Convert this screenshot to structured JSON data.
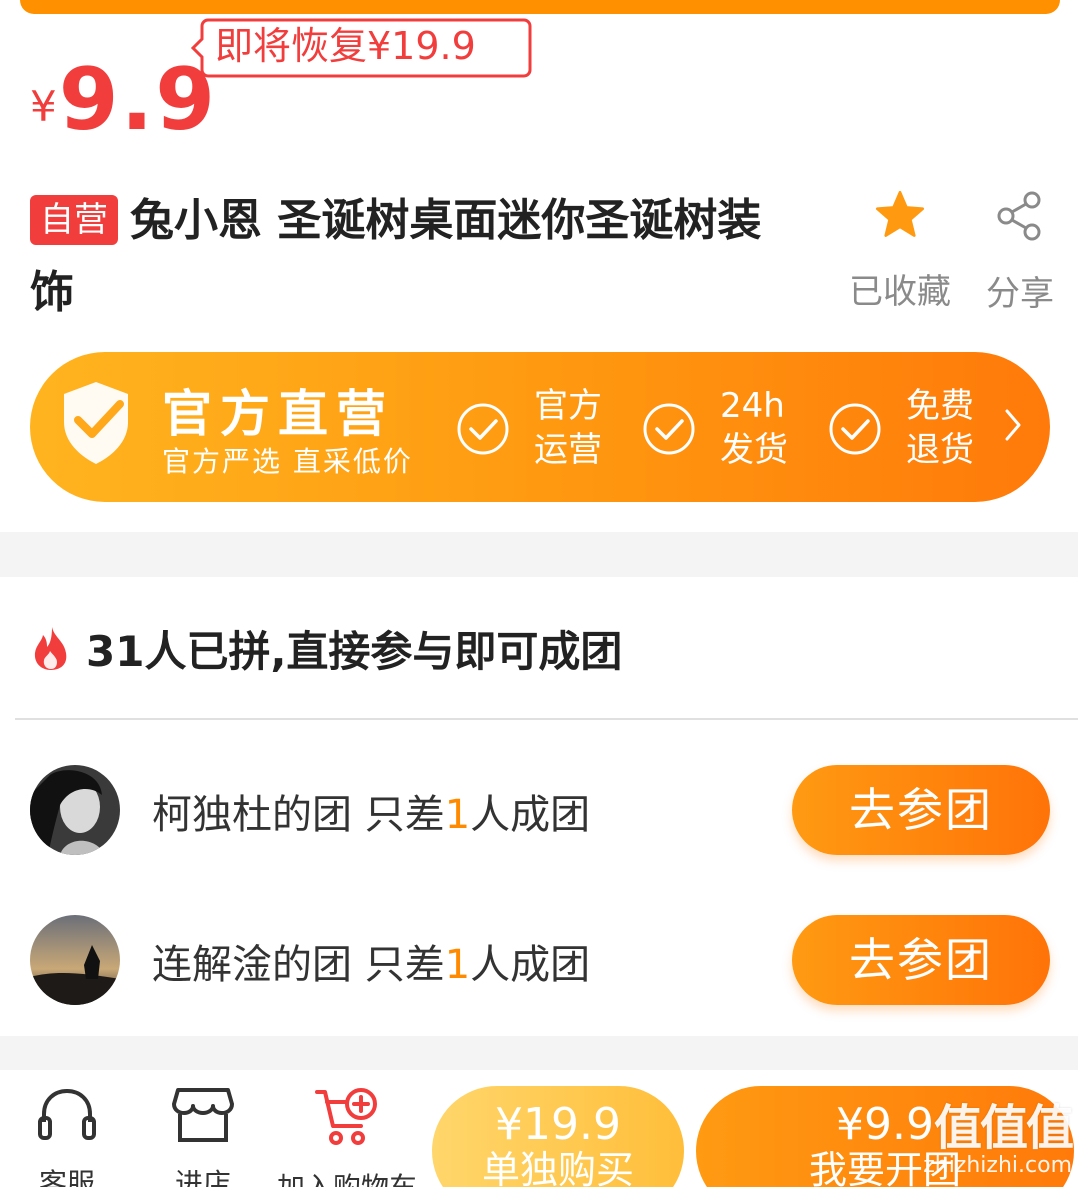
{
  "price": {
    "symbol": "¥",
    "value": "9.9",
    "restore_label": "即将恢复¥19.9"
  },
  "product": {
    "badge": "自营",
    "title": "兔小恩 圣诞树桌面迷你圣诞树装饰"
  },
  "actions": {
    "favorite_label": "已收藏",
    "share_label": "分享"
  },
  "official": {
    "title": "官方直营",
    "subtitle": "官方严选 直采低价",
    "features": [
      {
        "line1": "官方",
        "line2": "运营"
      },
      {
        "line1": "24h",
        "line2": "发货"
      },
      {
        "line1": "免费",
        "line2": "退货"
      }
    ]
  },
  "group": {
    "header": "31人已拼,直接参与即可成团",
    "rows": [
      {
        "prefix": "柯独杜的团 只差",
        "count": "1",
        "suffix": "人成团",
        "button": "去参团"
      },
      {
        "prefix": "连解淦的团 只差",
        "count": "1",
        "suffix": "人成团",
        "button": "去参团"
      }
    ]
  },
  "bottom_bar": {
    "service_label": "客服",
    "shop_label": "进店",
    "cart_label": "加入购物车",
    "buy_alone": {
      "price": "¥19.9",
      "label": "单独购买"
    },
    "buy_group": {
      "price": "¥9.9",
      "label": "我要开团"
    }
  },
  "watermark": {
    "big": "值值值",
    "small": "zhizhizhi.com"
  },
  "colors": {
    "price_red": "#f23d3d",
    "accent_orange": "#ff8a00",
    "gold": "#ffbe3a"
  }
}
